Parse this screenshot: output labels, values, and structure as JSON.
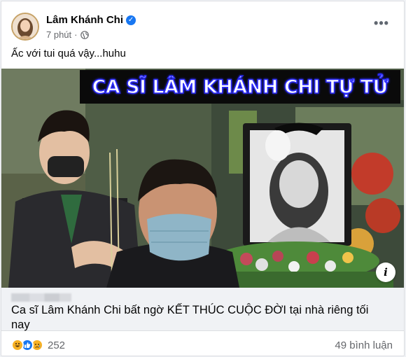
{
  "post": {
    "author": "Lâm Khánh Chi",
    "time": "7 phút",
    "caption": "Ấc với tui quá vậy...huhu",
    "more_label": "•••"
  },
  "media": {
    "headline": "CA SĨ LÂM KHÁNH CHI TỰ TỬ",
    "info_label": "i"
  },
  "link": {
    "title": "Ca sĩ Lâm Khánh Chi bất ngờ KẾT THÚC CUỘC ĐỜI tại nhà riêng tối nay"
  },
  "footer": {
    "reaction_count": "252",
    "comments": "49 bình luận"
  },
  "icons": {
    "verified": "verified-badge-icon",
    "privacy": "globe-icon",
    "reactions": [
      "haha-icon",
      "like-icon",
      "sad-icon"
    ]
  },
  "colors": {
    "accent": "#1877f2",
    "headline_glow": "#2b2bff",
    "muted_text": "#65676b"
  }
}
